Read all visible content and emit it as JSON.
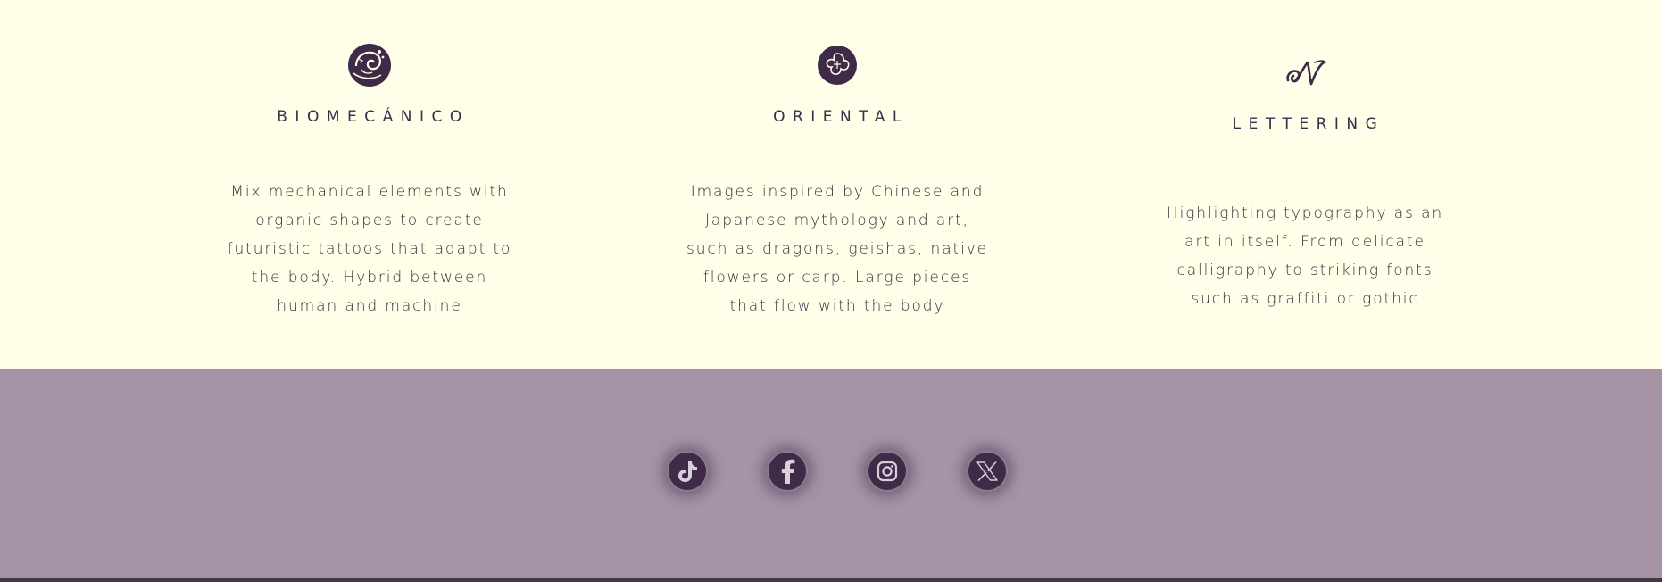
{
  "styles": [
    {
      "icon": "biomechanical-swirl-icon",
      "title": "BIOMECÁNICO",
      "description": "Mix mechanical elements with organic shapes to create futuristic tattoos that adapt to the body. Hybrid between human and machine"
    },
    {
      "icon": "oriental-flower-icon",
      "title": "ORIENTAL",
      "description": "Images inspired by Chinese and Japanese mythology and art, such as dragons, geishas, native flowers or carp. Large pieces that flow with the body"
    },
    {
      "icon": "lettering-script-n-icon",
      "title": "LETTERING",
      "description": "Highlighting typography as an art in itself. From delicate calligraphy to striking fonts such as graffiti or gothic"
    }
  ],
  "footer": {
    "social": [
      {
        "name": "tiktok",
        "icon": "tiktok-icon"
      },
      {
        "name": "facebook",
        "icon": "facebook-icon"
      },
      {
        "name": "instagram",
        "icon": "instagram-icon"
      },
      {
        "name": "x",
        "icon": "x-icon"
      }
    ]
  },
  "colors": {
    "section_background": "#fefee9",
    "footer_background": "#a694a6",
    "accent_dark_purple": "#3f2a47",
    "icon_ring": "#8d7a8f"
  }
}
